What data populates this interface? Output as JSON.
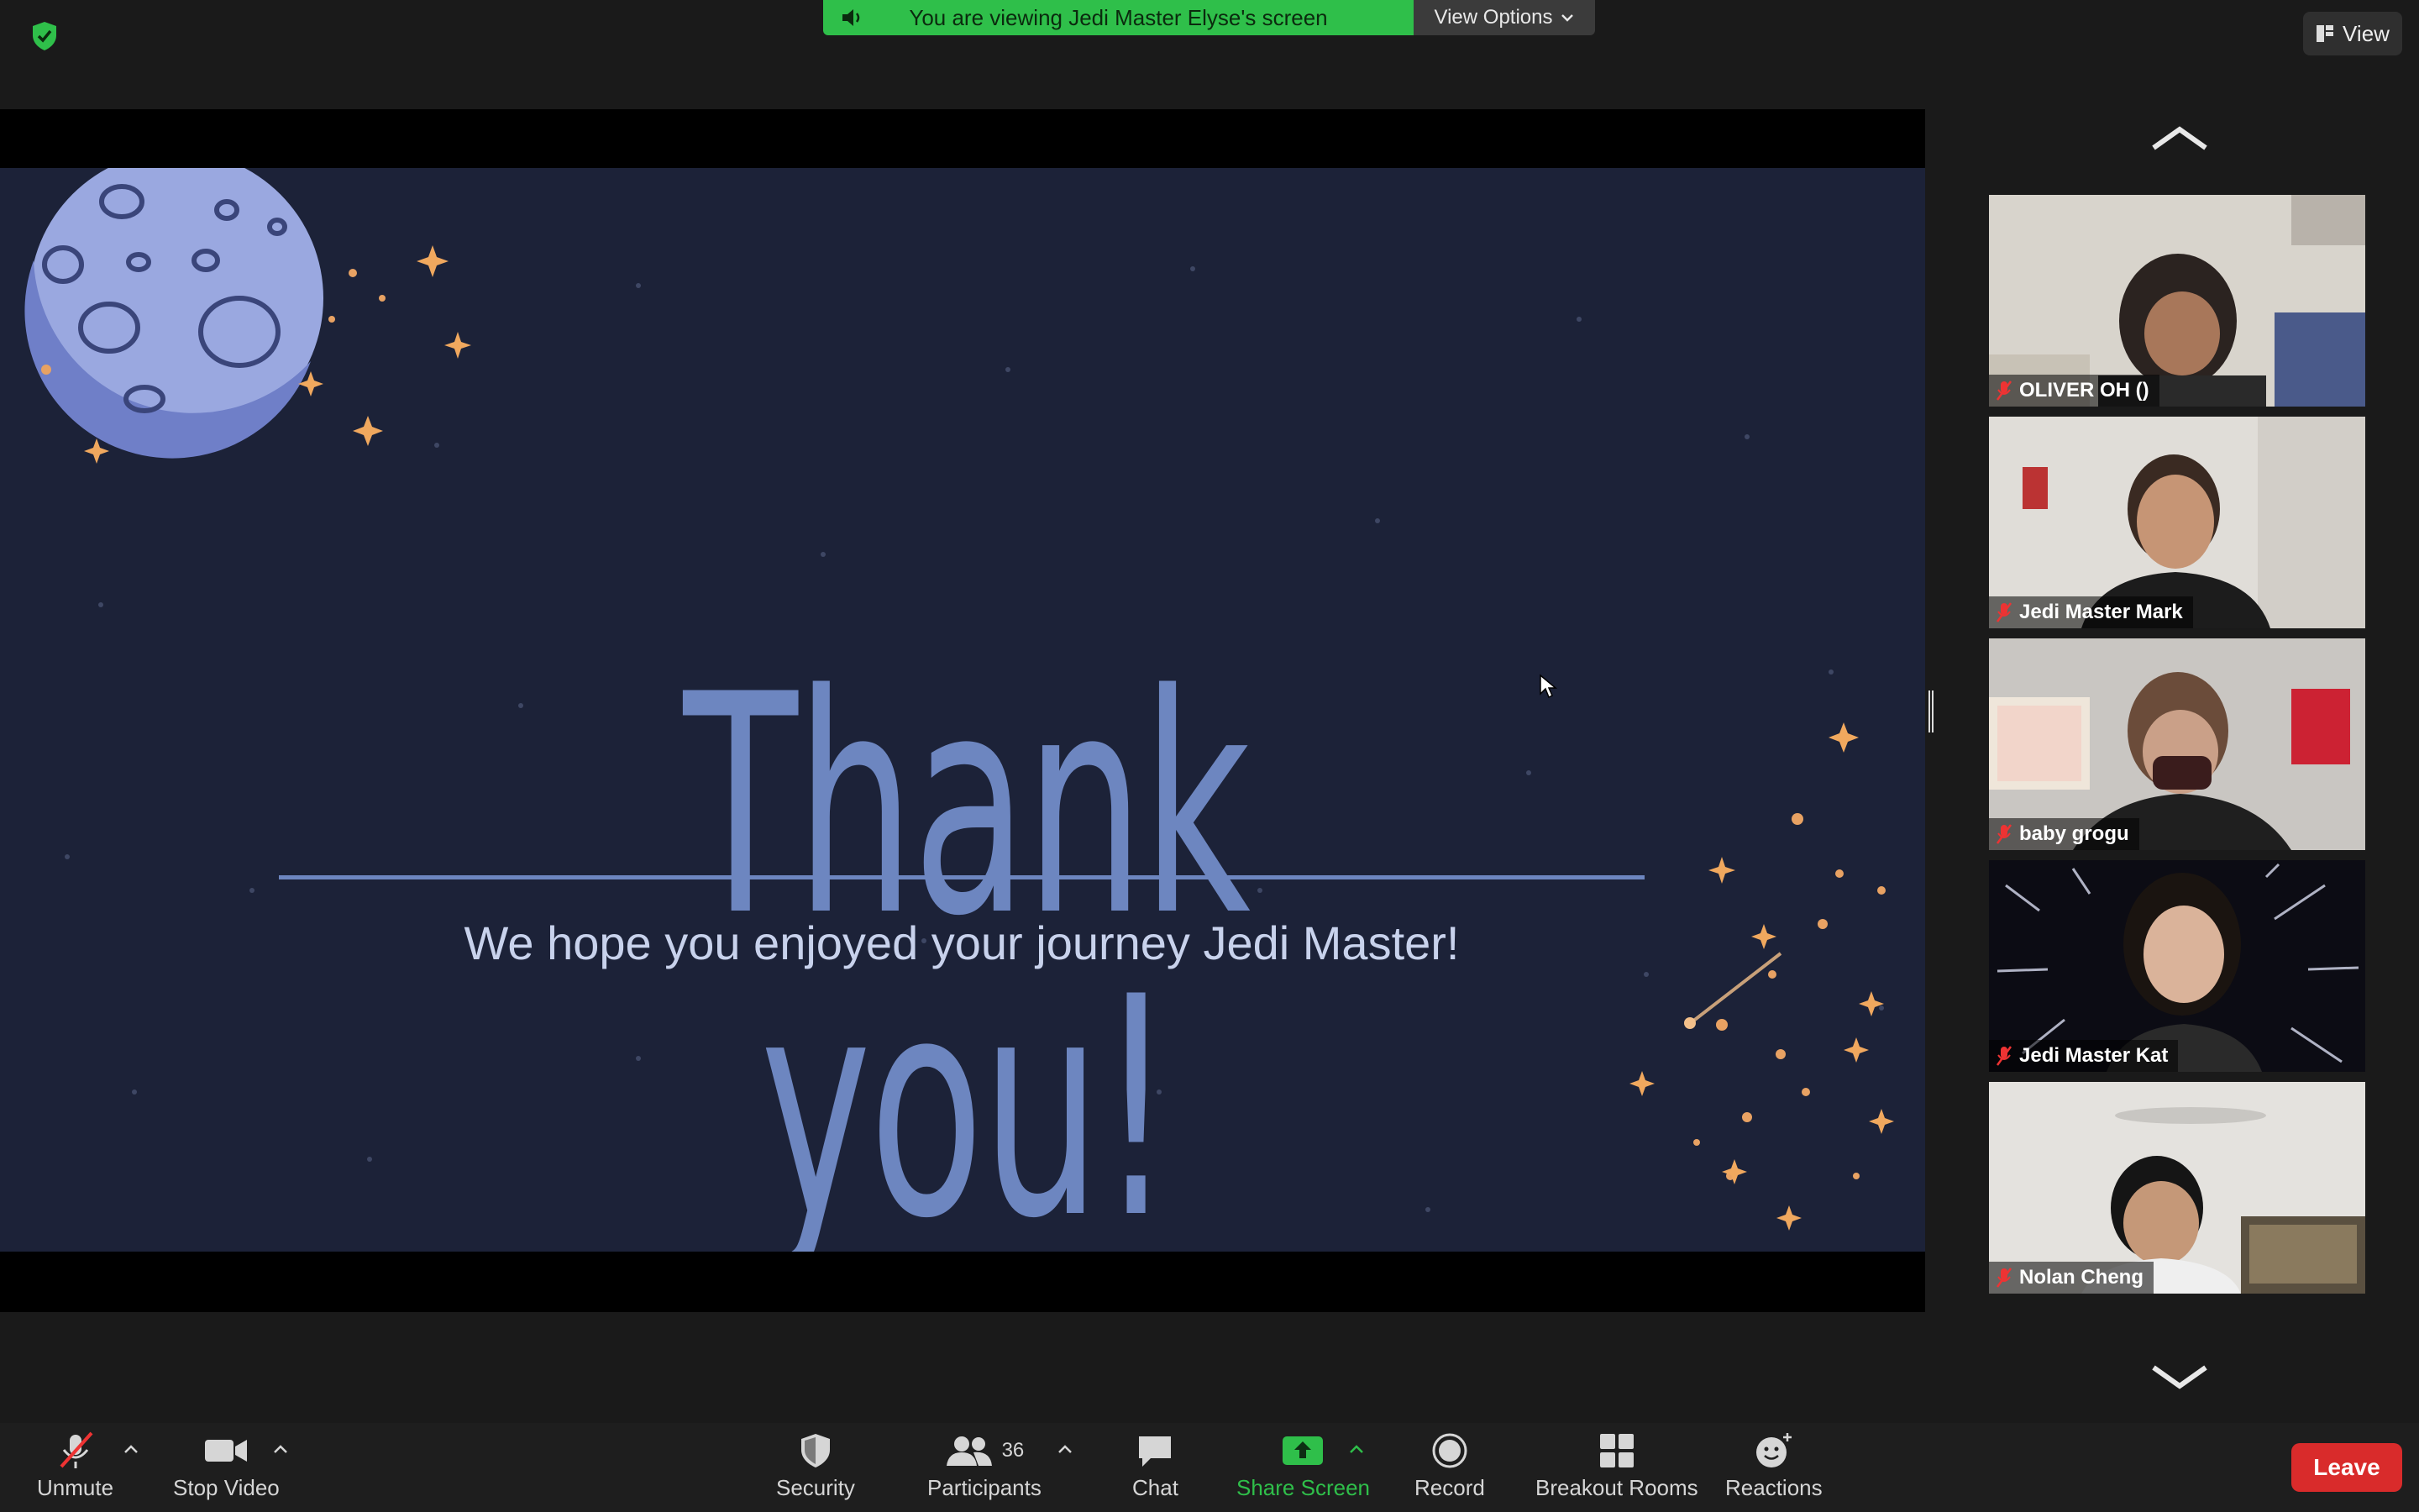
{
  "top": {
    "banner_text": "You are viewing Jedi Master Elyse's screen",
    "view_options": "View Options",
    "view_button": "View"
  },
  "slide": {
    "title": "Thank you!",
    "subtitle": "We hope you enjoyed your journey Jedi Master!"
  },
  "participants": [
    {
      "name": "OLIVER OH ()",
      "muted": true
    },
    {
      "name": "Jedi Master Mark",
      "muted": true
    },
    {
      "name": "baby grogu",
      "muted": true
    },
    {
      "name": "Jedi Master Kat",
      "muted": true
    },
    {
      "name": "Nolan Cheng",
      "muted": true
    }
  ],
  "toolbar": {
    "unmute": "Unmute",
    "stop_video": "Stop Video",
    "security": "Security",
    "participants": "Participants",
    "participants_count": "36",
    "chat": "Chat",
    "share_screen": "Share Screen",
    "record": "Record",
    "breakout_rooms": "Breakout Rooms",
    "reactions": "Reactions",
    "leave": "Leave"
  },
  "colors": {
    "banner_green": "#2fbf4a",
    "share_green": "#2fbf4a",
    "leave_red": "#d92b2b",
    "slide_bg": "#1c2238",
    "slide_accent": "#6d86c0"
  },
  "icons": [
    "shield-icon",
    "speaker-icon",
    "chevron-down-icon",
    "view-grid-icon",
    "arrow-up-icon",
    "arrow-down-icon",
    "mic-muted-icon",
    "video-camera-icon",
    "security-shield-icon",
    "participants-icon",
    "chat-icon",
    "share-screen-icon",
    "record-icon",
    "breakout-rooms-icon",
    "reactions-icon"
  ]
}
